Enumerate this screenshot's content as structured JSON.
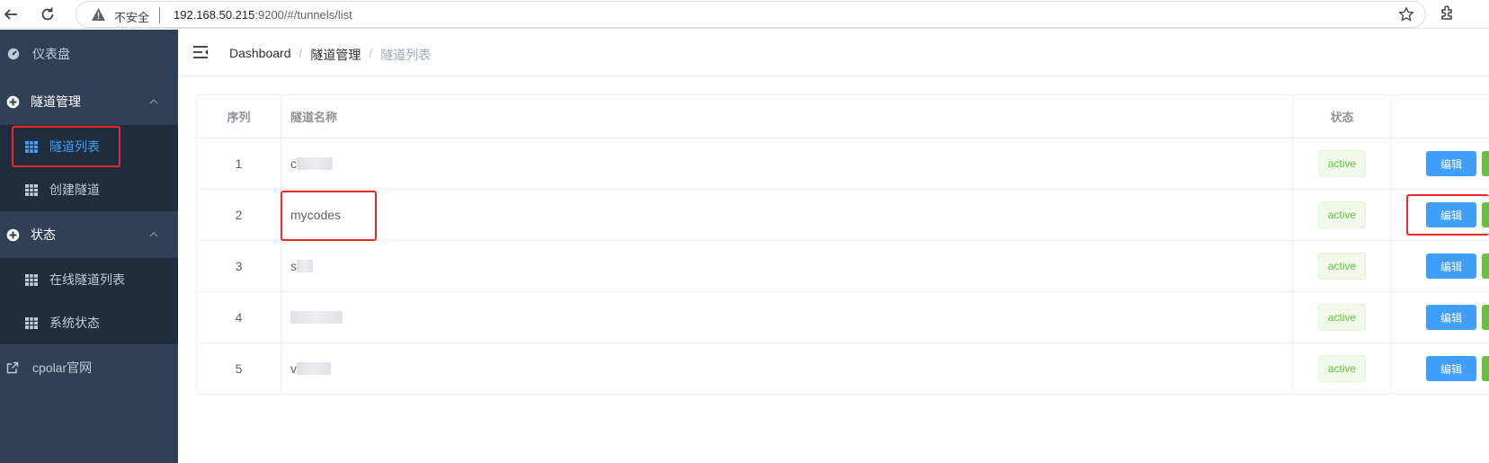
{
  "browser": {
    "insecure_label": "不安全",
    "url_host": "192.168.50.215",
    "url_rest": ":9200/#/tunnels/list"
  },
  "sidebar": {
    "dashboard": "仪表盘",
    "tunnel_mgmt": "隧道管理",
    "tunnel_list": "隧道列表",
    "create_tunnel": "创建隧道",
    "status": "状态",
    "online_tunnels": "在线隧道列表",
    "system_status": "系统状态",
    "official_site": "cpolar官网"
  },
  "breadcrumb": {
    "home": "Dashboard",
    "section": "隧道管理",
    "current": "隧道列表"
  },
  "table": {
    "headers": {
      "index": "序列",
      "name": "隧道名称",
      "status": "状态"
    },
    "rows": [
      {
        "index": "1",
        "name": "c",
        "status": "active",
        "edit": "编辑"
      },
      {
        "index": "2",
        "name": "mycodes",
        "status": "active",
        "edit": "编辑"
      },
      {
        "index": "3",
        "name": "s",
        "status": "active",
        "edit": "编辑"
      },
      {
        "index": "4",
        "name": "",
        "status": "active",
        "edit": "编辑"
      },
      {
        "index": "5",
        "name": "v",
        "status": "active",
        "edit": "编辑"
      }
    ]
  },
  "colors": {
    "sidebar_bg": "#304156",
    "submenu_bg": "#1f2d3d",
    "active": "#409eff",
    "tag_green": "#67c23a",
    "highlight_red": "#f0262d"
  }
}
